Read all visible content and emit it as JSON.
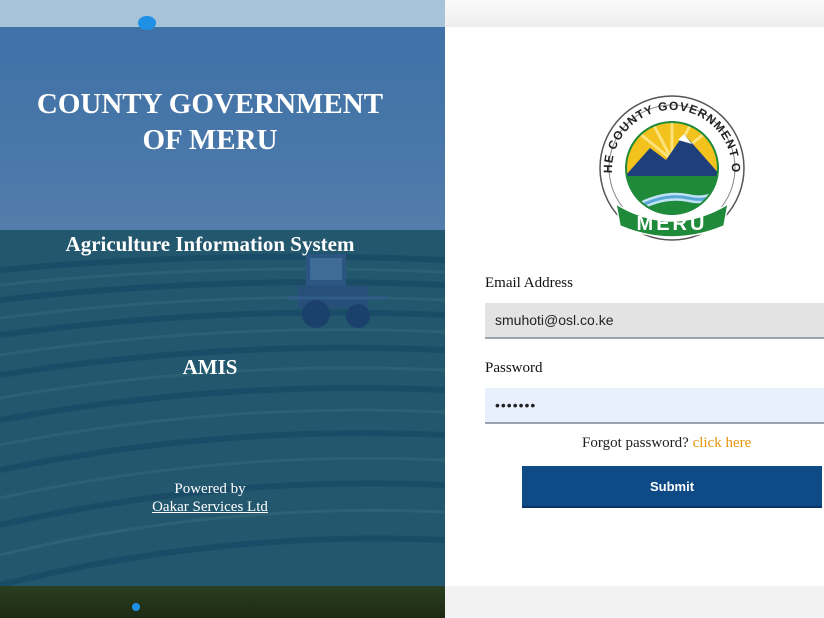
{
  "hero": {
    "title_line1": "COUNTY GOVERNMENT",
    "title_line2": "OF MERU",
    "system_name": "Agriculture Information System",
    "abbreviation": "AMIS",
    "powered_by": "Powered by",
    "company_link": "Oakar Services Ltd"
  },
  "logo": {
    "ring_text": "THE COUNTY GOVERNMENT OF",
    "banner_text": "MERU"
  },
  "form": {
    "email_label": "Email Address",
    "email_value": "smuhoti@osl.co.ke",
    "password_label": "Password",
    "password_value": "•••••••",
    "forgot_text": "Forgot password?",
    "forgot_link": "click here",
    "submit_label": "Submit"
  },
  "colors": {
    "overlay": "#10488c",
    "submit": "#0e4a86",
    "link": "#e8950c"
  }
}
